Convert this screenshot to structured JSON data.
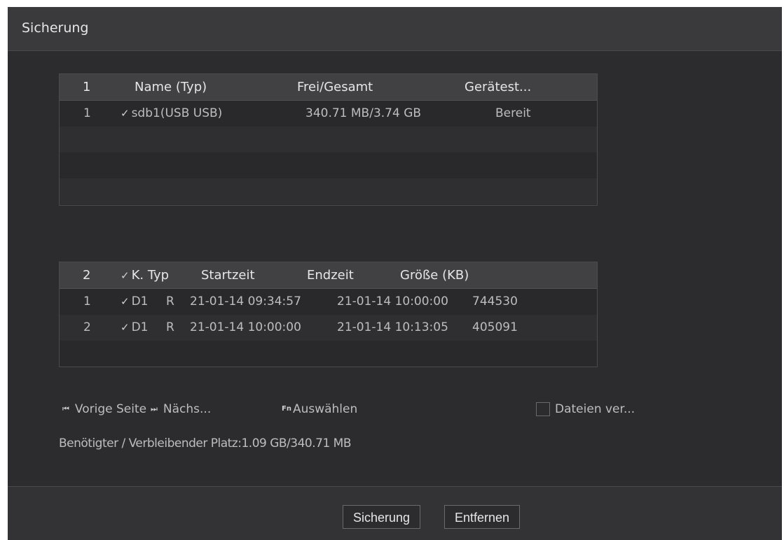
{
  "window": {
    "title": "Sicherung"
  },
  "devices": {
    "headers": [
      "1",
      "Name (Typ)",
      "Frei/Gesamt",
      "Gerätest..."
    ],
    "rows": [
      {
        "index": "1",
        "checked": "✓",
        "name": "sdb1(USB USB)",
        "free_total": "340.71 MB/3.74 GB",
        "status": "Bereit"
      }
    ]
  },
  "files": {
    "headers": {
      "count": "2",
      "check": "✓",
      "type": "K. Typ",
      "start": "Startzeit",
      "end": "Endzeit",
      "size": "Größe (KB)"
    },
    "rows": [
      {
        "index": "1",
        "checked": "✓",
        "channel": "D1",
        "type": "R",
        "start": "21-01-14 09:34:57",
        "end": "21-01-14 10:00:00",
        "size": "744530"
      },
      {
        "index": "2",
        "checked": "✓",
        "channel": "D1",
        "type": "R",
        "start": "21-01-14 10:00:00",
        "end": "21-01-14 10:13:05",
        "size": "405091"
      }
    ]
  },
  "nav": {
    "prev_icon": "⏮",
    "prev_label": "Vorige Seite",
    "next_icon": "⏭",
    "next_label": "Nächs...",
    "fn_icon": "Fn",
    "select_label": "Auswählen",
    "encrypt_label": "Dateien ver..."
  },
  "space": {
    "label": "Benötigter / Verbleibender Platz:",
    "value": "1.09 GB/340.71 MB"
  },
  "buttons": {
    "backup": "Sicherung",
    "remove": "Entfernen"
  }
}
